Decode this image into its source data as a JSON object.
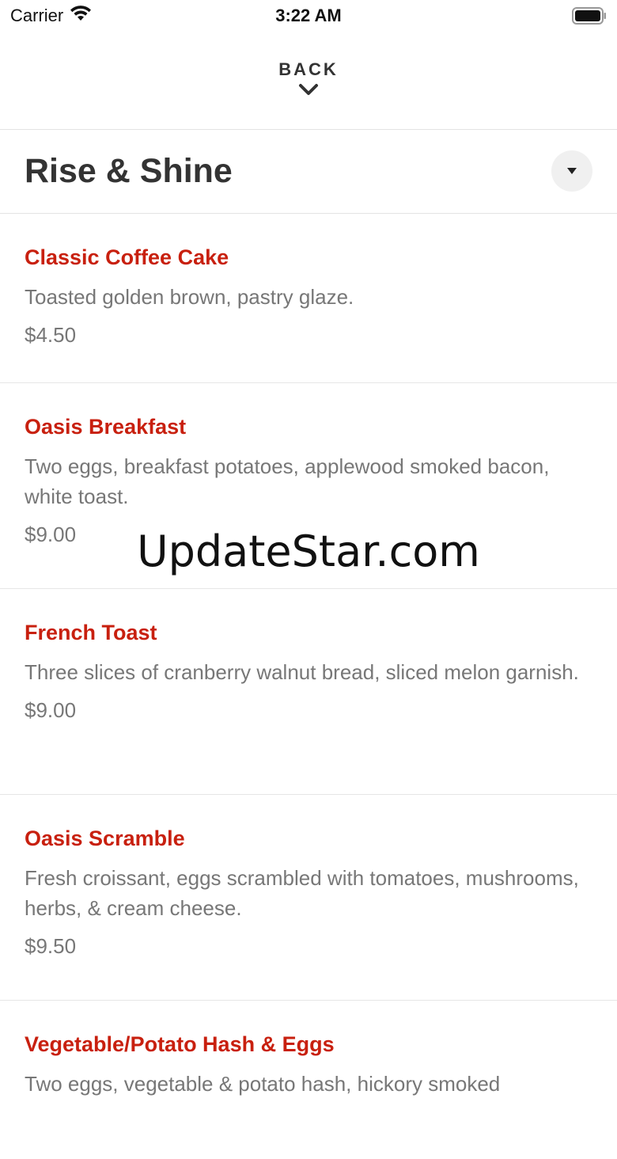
{
  "status_bar": {
    "carrier": "Carrier",
    "time": "3:22 AM"
  },
  "nav": {
    "back_label": "BACK"
  },
  "section": {
    "title": "Rise & Shine"
  },
  "menu": {
    "items": [
      {
        "name": "Classic Coffee Cake",
        "description": "Toasted golden brown, pastry glaze.",
        "price": "$4.50"
      },
      {
        "name": "Oasis Breakfast",
        "description": "Two eggs, breakfast potatoes, applewood smoked bacon, white toast.",
        "price": "$9.00"
      },
      {
        "name": "French Toast",
        "description": "Three slices of cranberry walnut bread, sliced melon garnish.",
        "price": "$9.00"
      },
      {
        "name": "Oasis Scramble",
        "description": "Fresh croissant, eggs scrambled with tomatoes, mushrooms, herbs, & cream cheese.",
        "price": "$9.50"
      },
      {
        "name": "Vegetable/Potato Hash & Eggs",
        "description": "Two eggs, vegetable & potato hash, hickory smoked",
        "price": ""
      }
    ]
  },
  "watermark": {
    "text": "UpdateStar.com"
  },
  "colors": {
    "item_name": "#c8200f",
    "text_primary": "#333333",
    "text_secondary": "#777777",
    "divider": "#e3e3e3"
  },
  "icons": {
    "wifi": "wifi-icon",
    "battery": "battery-icon",
    "back_chevron": "chevron-down-icon",
    "dropdown": "caret-down-icon"
  }
}
